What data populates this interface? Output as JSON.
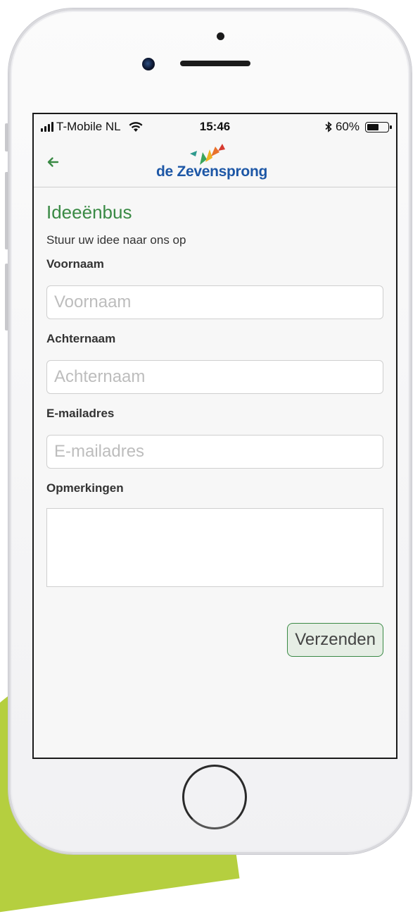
{
  "status_bar": {
    "carrier": "T-Mobile NL",
    "time": "15:46",
    "battery_percent": "60%",
    "battery_level": 0.6,
    "icons": [
      "signal-icon",
      "wifi-icon",
      "bluetooth-icon",
      "battery-icon"
    ]
  },
  "nav": {
    "back_icon": "arrow-left-icon",
    "logo_text": "de Zevensprong"
  },
  "form": {
    "title": "Ideeënbus",
    "subtitle": "Stuur uw idee naar ons op",
    "fields": [
      {
        "label": "Voornaam",
        "placeholder": "Voornaam",
        "value": ""
      },
      {
        "label": "Achternaam",
        "placeholder": "Achternaam",
        "value": ""
      },
      {
        "label": "E-mailadres",
        "placeholder": "E-mailadres",
        "value": ""
      }
    ],
    "remarks_label": "Opmerkingen",
    "remarks_value": "",
    "submit_label": "Verzenden"
  },
  "colors": {
    "accent_green": "#3a8a45",
    "logo_blue": "#1d57a6",
    "background_lime": "#b5cf3f"
  }
}
